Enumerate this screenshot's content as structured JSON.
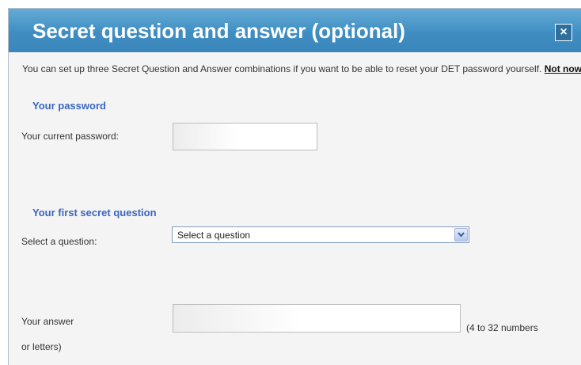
{
  "dialog": {
    "title": "Secret question and answer (optional)",
    "close_label": "×",
    "intro_text": "You can set up three Secret Question and Answer combinations if you want to be able to reset your DET password yourself.",
    "not_now_link": "Not now"
  },
  "password_section": {
    "heading": "Your password",
    "current_password_label": "Your current password:",
    "current_password_value": ""
  },
  "first_question": {
    "heading": "Your first secret question",
    "select_label": "Select a question:",
    "selected_option": "Select a question",
    "answer_label": "Your answer",
    "answer_value": "",
    "answer_hint": "(4 to 32 numbers",
    "answer_hint_continued": "or letters)"
  },
  "colors": {
    "titlebar": "#3f8dc2",
    "section_heading": "#3a66c0",
    "dialog_background": "#f4f4f4"
  }
}
